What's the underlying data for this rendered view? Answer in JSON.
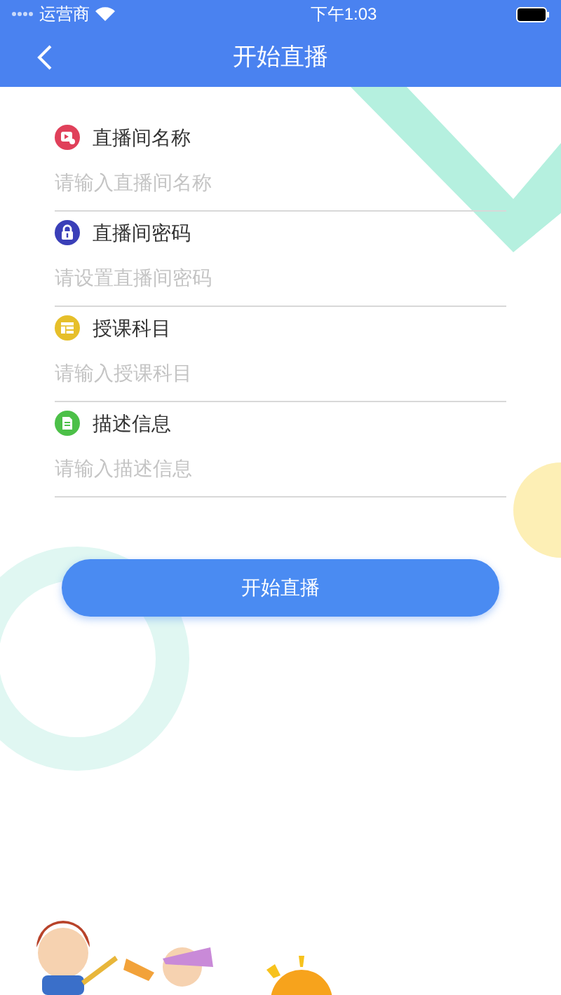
{
  "status_bar": {
    "carrier": "运营商",
    "time": "下午1:03"
  },
  "nav": {
    "title": "开始直播"
  },
  "fields": [
    {
      "kind": "video",
      "label": "直播间名称",
      "placeholder": "请输入直播间名称"
    },
    {
      "kind": "lock",
      "label": "直播间密码",
      "placeholder": "请设置直播间密码"
    },
    {
      "kind": "list",
      "label": "授课科目",
      "placeholder": "请输入授课科目"
    },
    {
      "kind": "document",
      "label": "描述信息",
      "placeholder": "请输入描述信息"
    }
  ],
  "submit_button": {
    "label": "开始直播"
  }
}
